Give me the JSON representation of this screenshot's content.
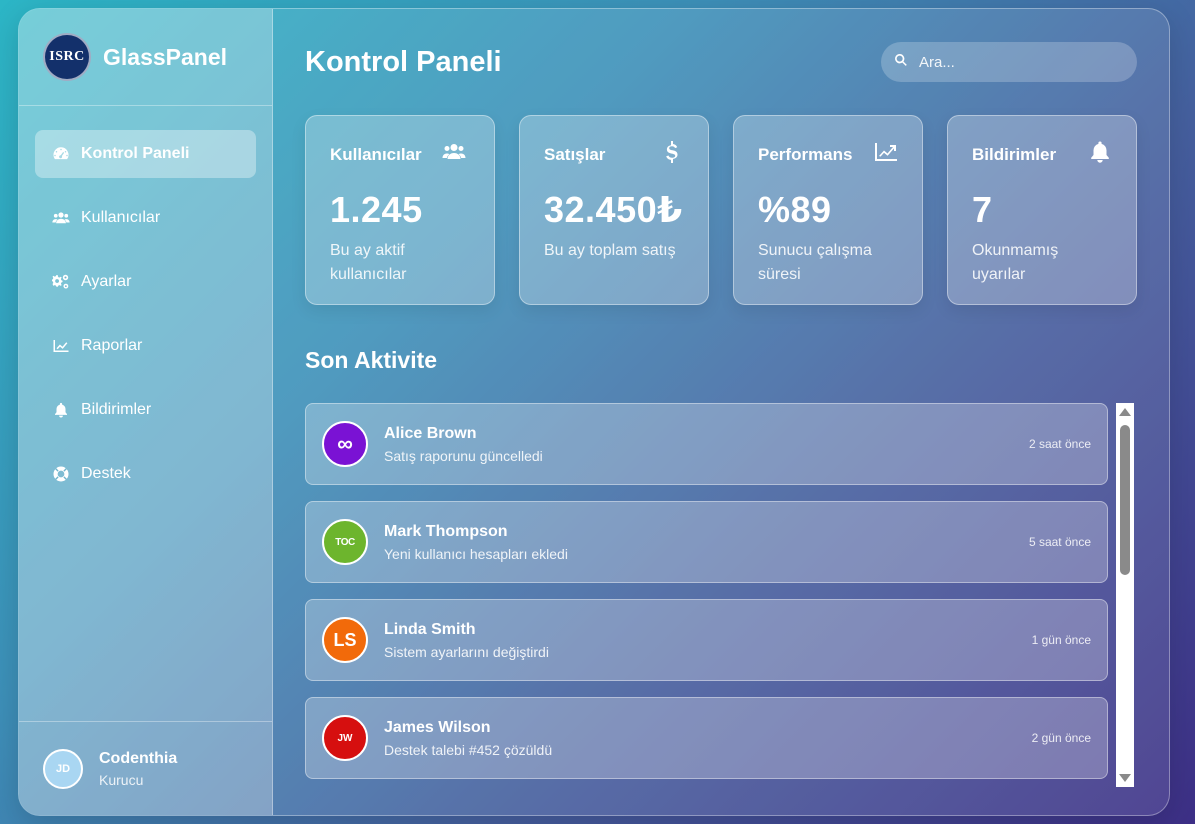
{
  "brand": {
    "logo_text": "ISRC",
    "name": "GlassPanel"
  },
  "sidebar": {
    "items": [
      {
        "label": "Kontrol Paneli",
        "icon": "gauge-icon",
        "active": true
      },
      {
        "label": "Kullanıcılar",
        "icon": "users-icon",
        "active": false
      },
      {
        "label": "Ayarlar",
        "icon": "gears-icon",
        "active": false
      },
      {
        "label": "Raporlar",
        "icon": "chart-line-icon",
        "active": false
      },
      {
        "label": "Bildirimler",
        "icon": "bell-icon",
        "active": false
      },
      {
        "label": "Destek",
        "icon": "lifebuoy-icon",
        "active": false
      }
    ]
  },
  "user": {
    "initials": "JD",
    "name": "Codenthia",
    "role": "Kurucu"
  },
  "header": {
    "title": "Kontrol Paneli"
  },
  "search": {
    "placeholder": "Ara..."
  },
  "cards": [
    {
      "title": "Kullanıcılar",
      "icon": "users-icon",
      "value": "1.245",
      "sub": "Bu ay aktif kullanıcılar"
    },
    {
      "title": "Satışlar",
      "icon": "dollar-icon",
      "value": "32.450₺",
      "sub": "Bu ay toplam satış"
    },
    {
      "title": "Performans",
      "icon": "chart-line-icon",
      "value": "%89",
      "sub": "Sunucu çalışma süresi"
    },
    {
      "title": "Bildirimler",
      "icon": "bell-icon",
      "value": "7",
      "sub": "Okunmamış uyarılar"
    }
  ],
  "activity": {
    "title": "Son Aktivite",
    "items": [
      {
        "name": "Alice Brown",
        "desc": "Satış raporunu güncelledi",
        "time": "2 saat önce",
        "avatar_text": "∞",
        "avatar_color": "#7a12d4"
      },
      {
        "name": "Mark Thompson",
        "desc": "Yeni kullanıcı hesapları ekledi",
        "time": "5 saat önce",
        "avatar_text": "TOC",
        "avatar_color": "#6db52d"
      },
      {
        "name": "Linda Smith",
        "desc": "Sistem ayarlarını değiştirdi",
        "time": "1 gün önce",
        "avatar_text": "LS",
        "avatar_color": "#f26a0a"
      },
      {
        "name": "James Wilson",
        "desc": "Destek talebi #452 çözüldü",
        "time": "2 gün önce",
        "avatar_text": "JW",
        "avatar_color": "#d60f0f"
      }
    ]
  },
  "colors": {
    "accent_dark": "#13306b",
    "scrollbar": "#8a8a8a"
  }
}
